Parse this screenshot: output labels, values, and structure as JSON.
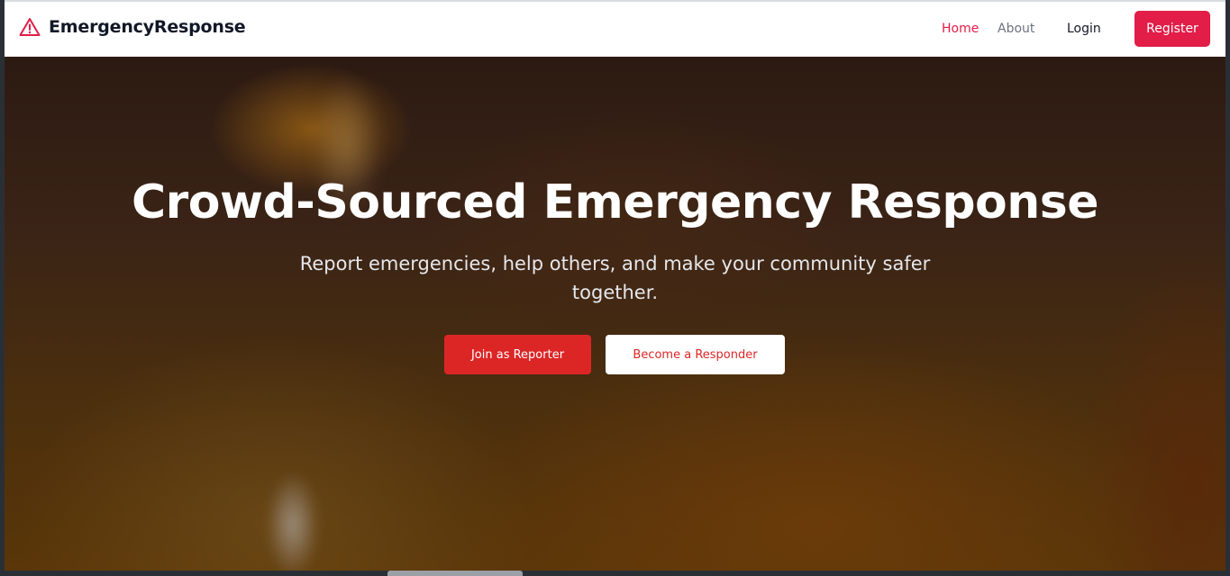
{
  "navbar": {
    "brand_icon": "warning-triangle-icon",
    "brand_name": "EmergencyResponse",
    "links": {
      "home": "Home",
      "about": "About",
      "login": "Login",
      "register": "Register"
    }
  },
  "hero": {
    "title": "Crowd-Sourced Emergency Response",
    "subtitle": "Report emergencies, help others, and make your community safer together.",
    "buttons": {
      "reporter": "Join as Reporter",
      "responder": "Become a Responder"
    }
  },
  "colors": {
    "accent": "#e11d48",
    "primary_button": "#dc2626",
    "nav_text": "#111827",
    "nav_muted": "#6b7280"
  }
}
